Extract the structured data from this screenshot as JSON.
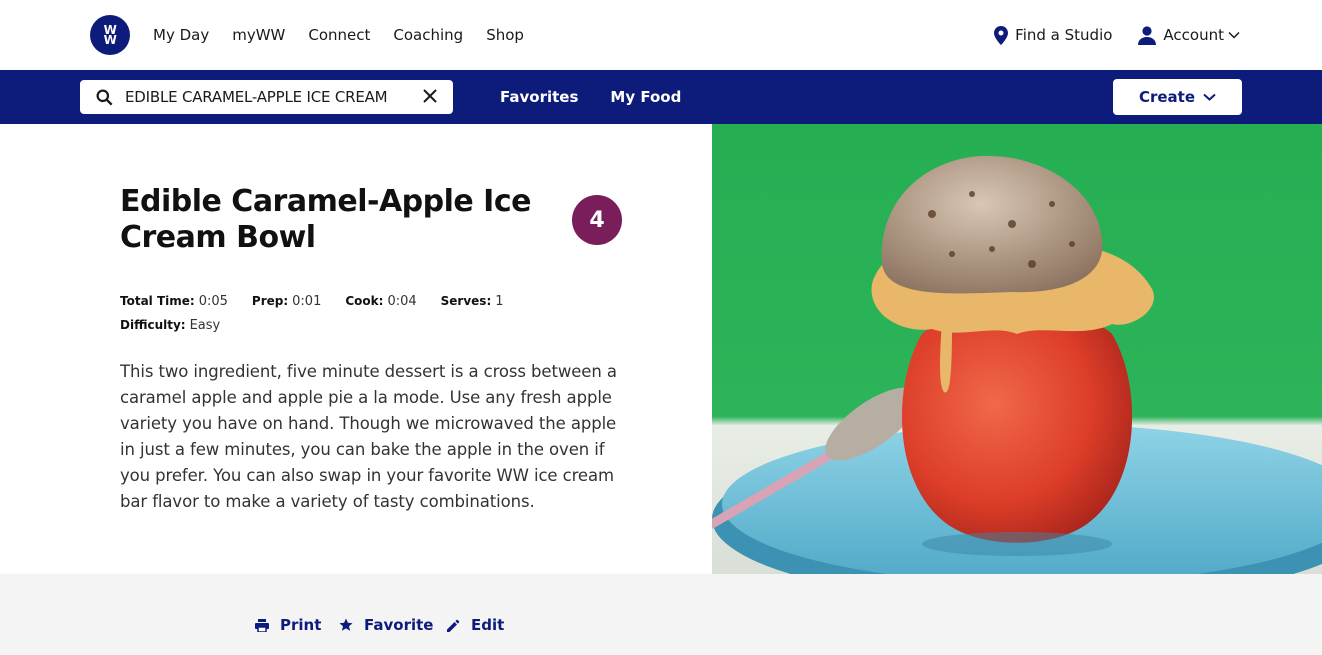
{
  "brand": {
    "logo_text_top": "W",
    "logo_text_bottom": "W",
    "color": "#0d1c7a"
  },
  "nav": {
    "links": [
      "My Day",
      "myWW",
      "Connect",
      "Coaching",
      "Shop"
    ],
    "find_studio": "Find a Studio",
    "account": "Account"
  },
  "subnav": {
    "search_value": "EDIBLE CARAMEL-APPLE ICE CREAM",
    "favorites": "Favorites",
    "my_food": "My Food",
    "create": "Create"
  },
  "recipe": {
    "title": "Edible Caramel-Apple Ice Cream Bowl",
    "points": "4",
    "points_color": "#7a1d5b",
    "meta": {
      "total_time_label": "Total Time:",
      "total_time": "0:05",
      "prep_label": "Prep:",
      "prep": "0:01",
      "cook_label": "Cook:",
      "cook": "0:04",
      "serves_label": "Serves:",
      "serves": "1",
      "difficulty_label": "Difficulty:",
      "difficulty": "Easy"
    },
    "description": "This two ingredient, five minute dessert is a cross between a caramel apple and apple pie a la mode. Use any fresh apple variety you have on hand. Though we microwaved the apple in just a few minutes, you can bake the apple in the oven if you prefer. You can also swap in your favorite WW ice cream bar flavor to make a variety of tasty combinations."
  },
  "actions": {
    "print": "Print",
    "favorite": "Favorite",
    "edit": "Edit"
  }
}
